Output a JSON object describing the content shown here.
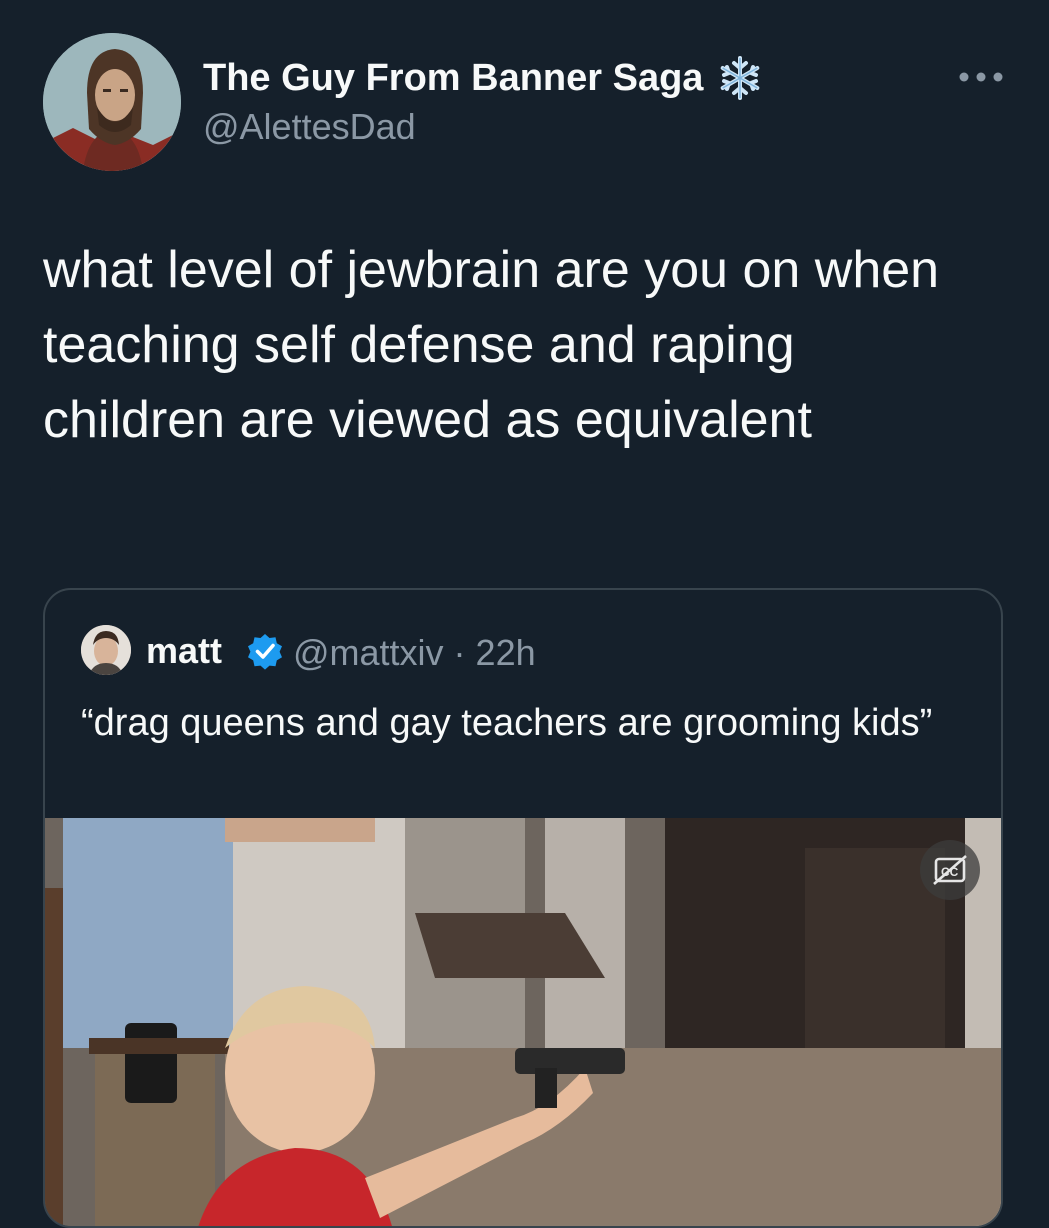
{
  "author": {
    "display_name": "The Guy From Banner Saga",
    "handle": "@AlettesDad",
    "badge_icon": "snowflake-icon"
  },
  "tweet": {
    "text": "what level of jewbrain are you on when teaching self defense and raping children are viewed as equivalent"
  },
  "quoted_tweet": {
    "display_name": "matt",
    "verified_icon": "verified-badge-icon",
    "handle_time": "@mattxiv · 22h",
    "text": "“drag queens and gay teachers are grooming kids”",
    "media_caption_icon": "closed-captions-off-icon"
  },
  "colors": {
    "background": "#15202b",
    "text": "#f7f9f9",
    "secondary": "#8b98a5",
    "border": "#38444d",
    "verified": "#1d9bf0"
  }
}
